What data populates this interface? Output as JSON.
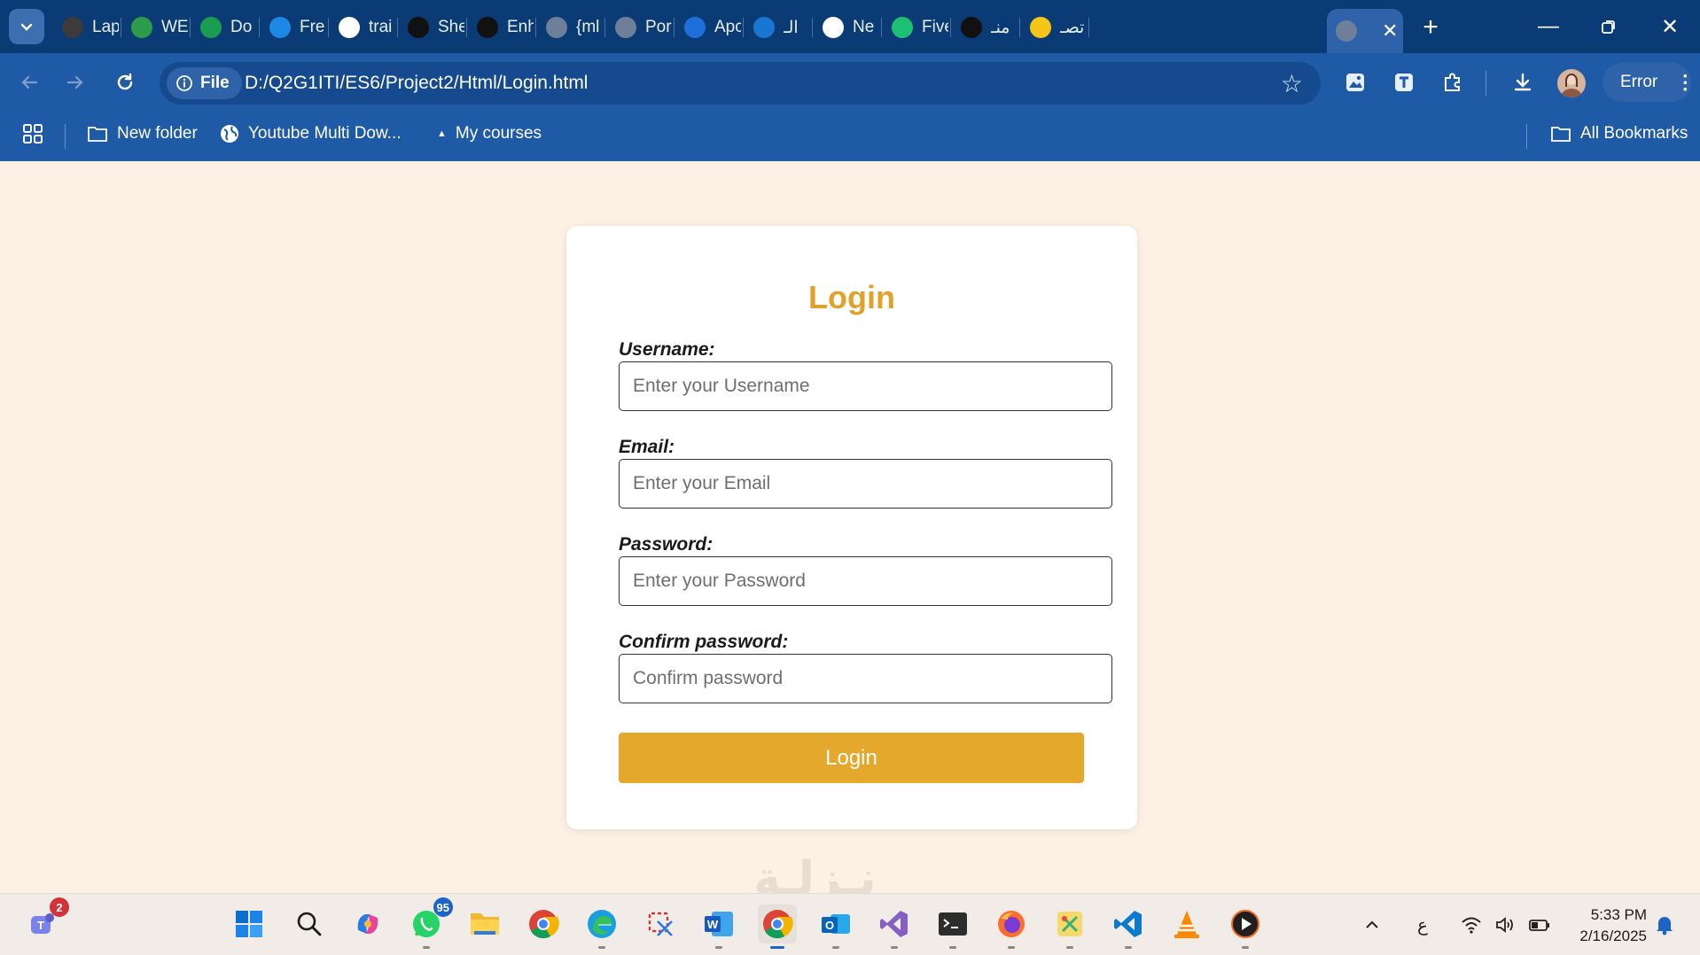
{
  "browser": {
    "tabs": [
      {
        "title": "Lap",
        "color": "#3b3b3b"
      },
      {
        "title": "WE",
        "color": "#2d9c4a"
      },
      {
        "title": "Do",
        "color": "#1a9d50"
      },
      {
        "title": "Fre",
        "color": "#1e88e5"
      },
      {
        "title": "trai",
        "color": "#ffffff"
      },
      {
        "title": "She",
        "color": "#111111"
      },
      {
        "title": "Enh",
        "color": "#111111"
      },
      {
        "title": "{ml",
        "color": "#6d7f99"
      },
      {
        "title": "Por",
        "color": "#6d7f99"
      },
      {
        "title": "Apc",
        "color": "#1e6fd9"
      },
      {
        "title": "الـ",
        "color": "#1976d2"
      },
      {
        "title": "Ne",
        "color": "#ffffff"
      },
      {
        "title": "Five",
        "color": "#1dbf73"
      },
      {
        "title": "منـ",
        "color": "#111111"
      },
      {
        "title": "تصـ",
        "color": "#f5c518"
      }
    ],
    "address": {
      "chip_label": "File",
      "url": "D:/Q2G1ITI/ES6/Project2/Html/Login.html"
    },
    "profile_label": "Error",
    "bookmarks": {
      "items": [
        "New folder",
        "Youtube Multi Dow...",
        "My courses"
      ],
      "all_label": "All Bookmarks"
    }
  },
  "form": {
    "title": "Login",
    "username": {
      "label": "Username:",
      "placeholder": "Enter your Username"
    },
    "email": {
      "label": "Email:",
      "placeholder": "Enter your Email"
    },
    "password": {
      "label": "Password:",
      "placeholder": "Enter your Password"
    },
    "confirm": {
      "label": "Confirm password:",
      "placeholder": "Confirm password"
    },
    "submit_label": "Login",
    "accent_color": "#e3a82c"
  },
  "watermark": "نـزلـة",
  "taskbar": {
    "teams_badge": "2",
    "whatsapp_badge": "95",
    "lang": "ع",
    "time": "5:33 PM",
    "date": "2/16/2025"
  }
}
